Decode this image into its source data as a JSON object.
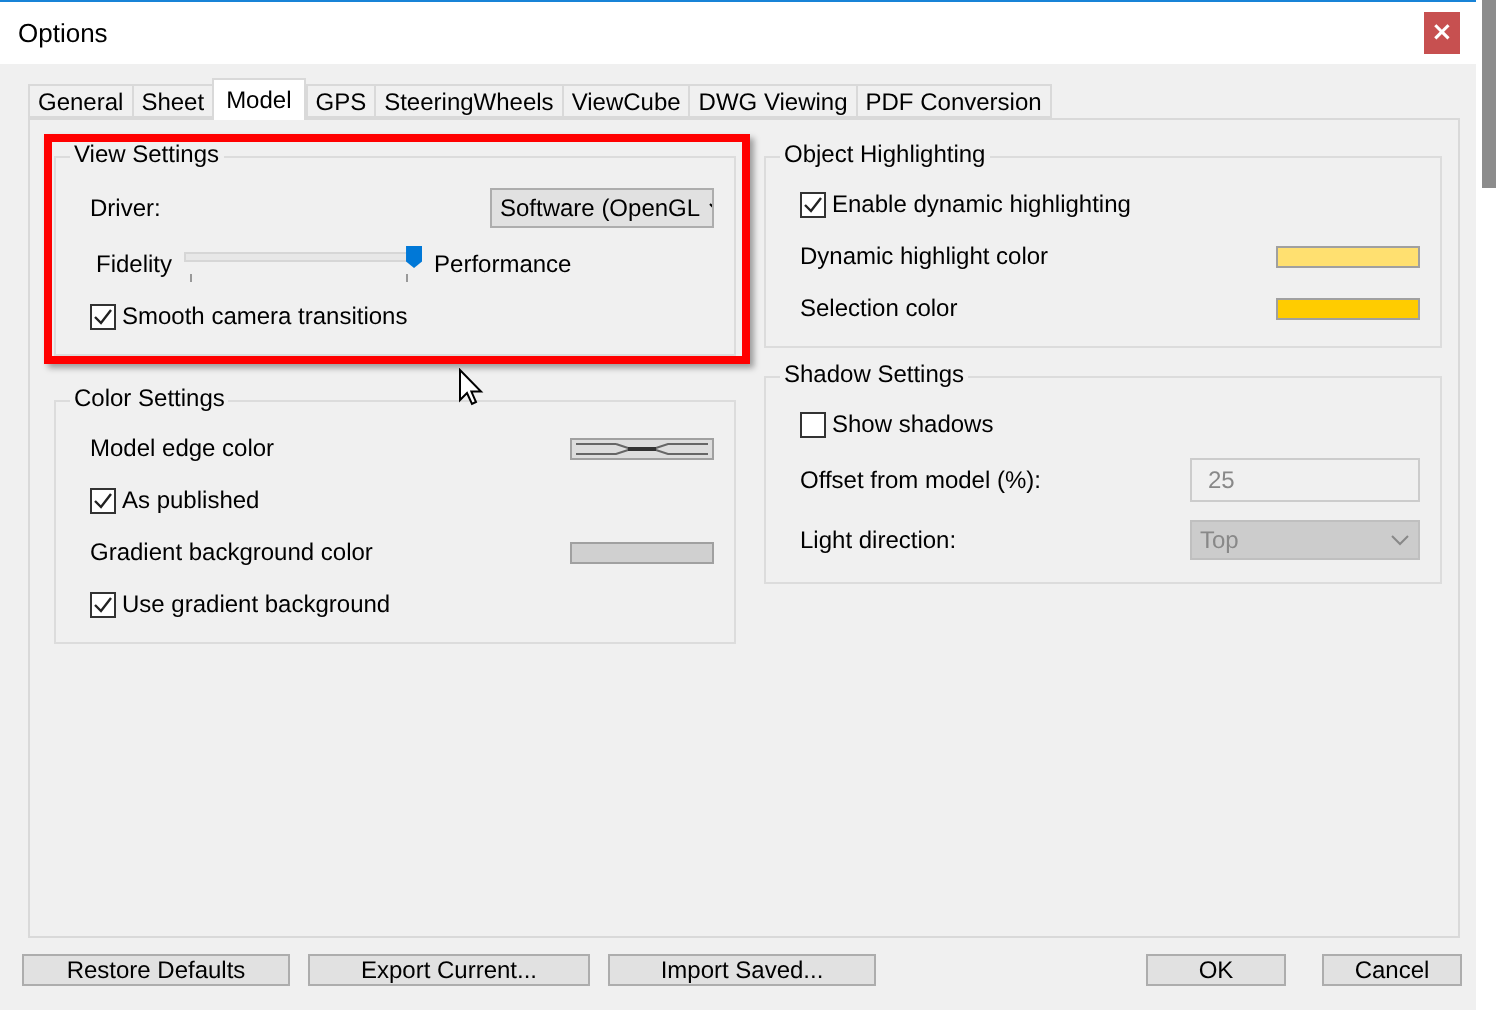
{
  "window": {
    "title": "Options",
    "close": "×"
  },
  "tabs": [
    {
      "label": "General",
      "selected": false
    },
    {
      "label": "Sheet",
      "selected": false
    },
    {
      "label": "Model",
      "selected": true
    },
    {
      "label": "GPS",
      "selected": false
    },
    {
      "label": "SteeringWheels",
      "selected": false
    },
    {
      "label": "ViewCube",
      "selected": false
    },
    {
      "label": "DWG Viewing",
      "selected": false
    },
    {
      "label": "PDF Conversion",
      "selected": false
    }
  ],
  "columns": [
    {
      "groups": [
        {
          "title": "View Settings",
          "highlighted": true,
          "rows": [
            {
              "kind": "dropdown",
              "label": "Driver:",
              "value": "Software (OpenGL",
              "disabled": false
            },
            {
              "kind": "slider",
              "label": "Fidelity",
              "end_label": "Performance",
              "level": 1
            },
            {
              "kind": "checkbox",
              "label": "Smooth camera transitions",
              "checked": true
            }
          ]
        },
        {
          "title": "Color Settings",
          "rows": [
            {
              "kind": "edge_swatch",
              "label": "Model edge color"
            },
            {
              "kind": "checkbox",
              "label": "As published",
              "checked": true
            },
            {
              "kind": "swatch",
              "label": "Gradient background color",
              "color": "#d0d0d0"
            },
            {
              "kind": "checkbox",
              "label": "Use gradient background",
              "checked": true
            }
          ]
        }
      ]
    },
    {
      "groups": [
        {
          "title": "Object Highlighting",
          "rows": [
            {
              "kind": "checkbox",
              "label": "Enable dynamic highlighting",
              "checked": true
            },
            {
              "kind": "swatch",
              "label": "Dynamic highlight color",
              "color": "#ffe070"
            },
            {
              "kind": "swatch",
              "label": "Selection color",
              "color": "#ffcc00"
            }
          ]
        },
        {
          "title": "Shadow Settings",
          "rows": [
            {
              "kind": "checkbox",
              "label": "Show shadows",
              "checked": false
            },
            {
              "kind": "field",
              "label": "Offset from model (%):",
              "value": "25",
              "disabled": true
            },
            {
              "kind": "dropdown",
              "label": "Light direction:",
              "value": "Top",
              "disabled": true
            }
          ]
        }
      ]
    }
  ],
  "buttons_left": [
    "Restore Defaults",
    "Export Current...",
    "Import Saved..."
  ],
  "buttons_right": [
    "OK",
    "Cancel"
  ]
}
